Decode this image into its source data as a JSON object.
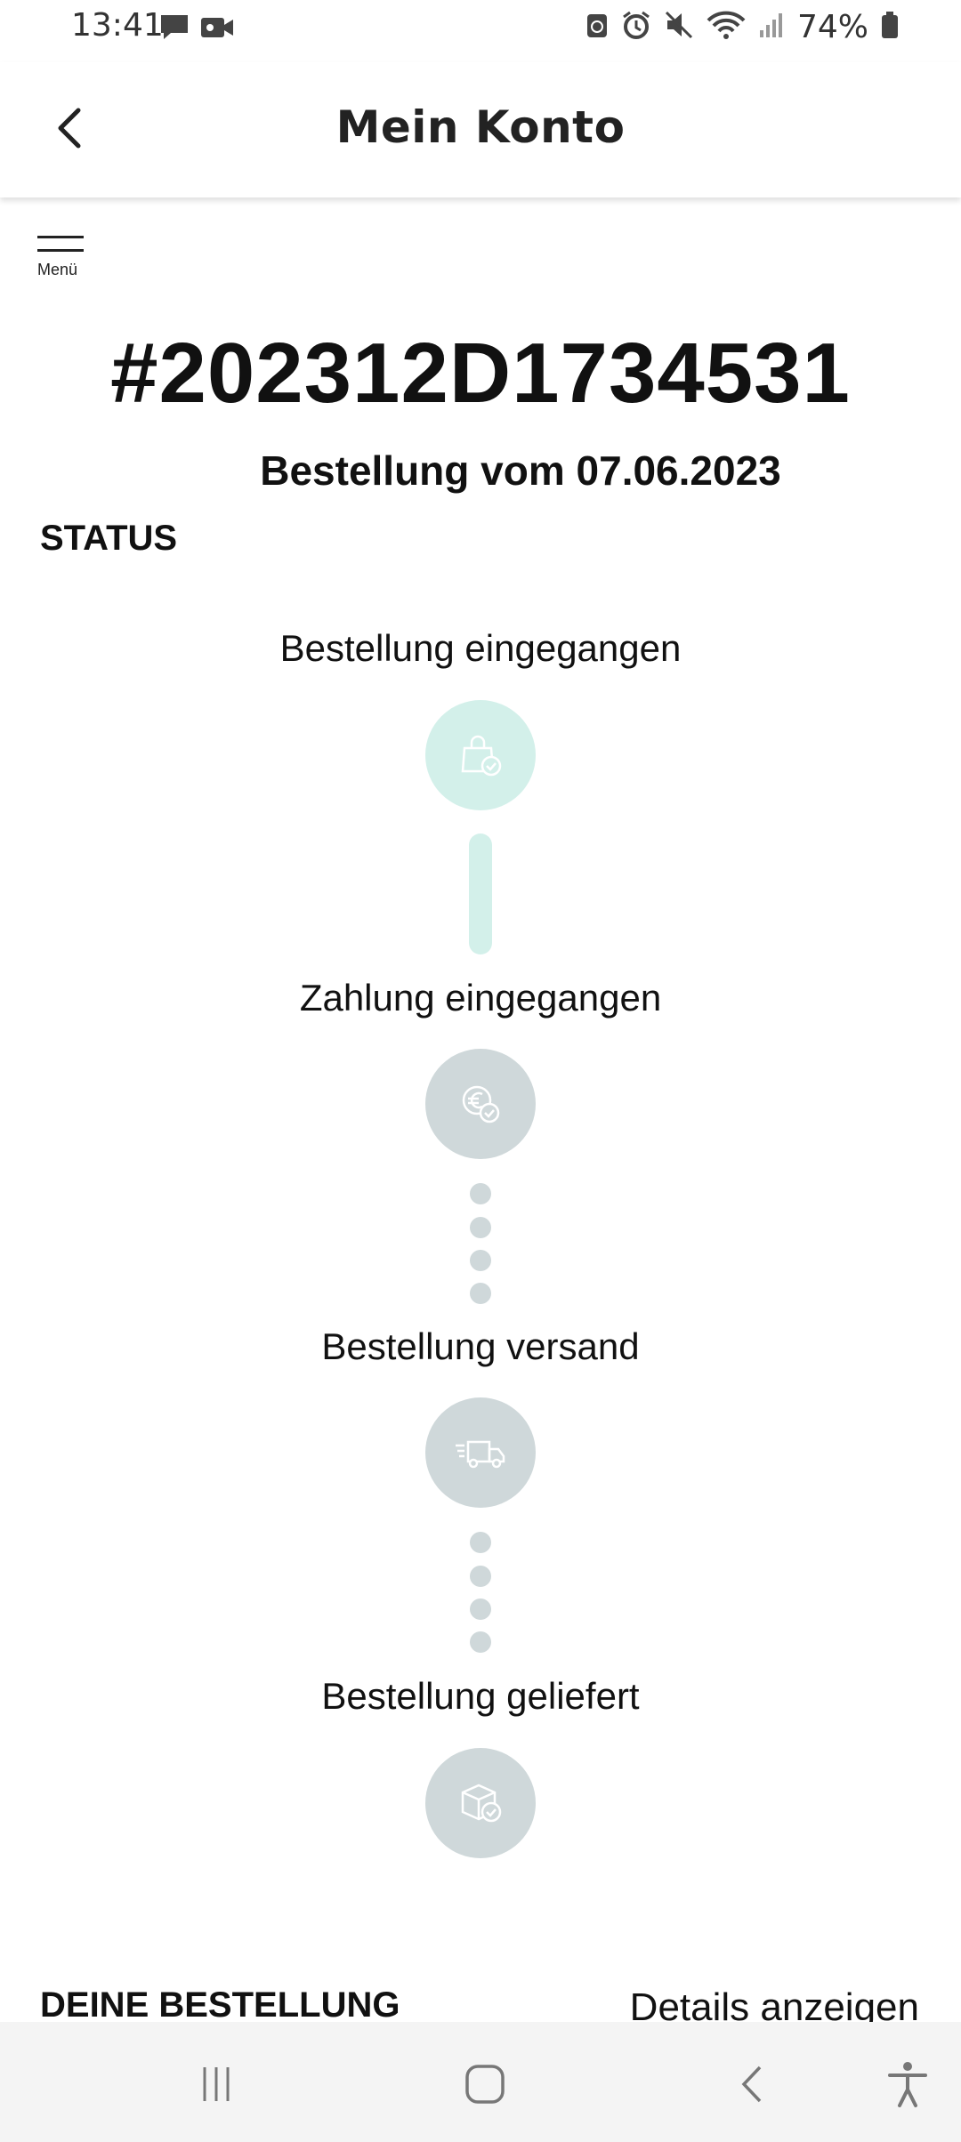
{
  "status_bar": {
    "time": "13:41",
    "battery": "74%",
    "icons": [
      "message-icon",
      "video-icon",
      "sync-icon",
      "alarm-icon",
      "mute-icon",
      "wifi-icon",
      "signal-icon",
      "battery-icon"
    ]
  },
  "header": {
    "title": "Mein Konto",
    "back_icon": "chevron-left-icon"
  },
  "menu": {
    "label": "Menü",
    "icon": "hamburger-icon"
  },
  "order": {
    "number": "#202312D1734531",
    "date": "Bestellung vom 07.06.2023"
  },
  "status_heading": "STATUS",
  "steps": [
    {
      "label": "Bestellung eingegangen",
      "icon": "shopping-bag-check-icon",
      "state": "done"
    },
    {
      "label": "Zahlung eingegangen",
      "icon": "euro-check-icon",
      "state": "pending"
    },
    {
      "label": "Bestellung versand",
      "icon": "delivery-truck-icon",
      "state": "pending"
    },
    {
      "label": "Bestellung geliefert",
      "icon": "package-check-icon",
      "state": "pending"
    }
  ],
  "your_order": {
    "heading": "DEINE BESTELLUNG",
    "details_link": "Details anzeigen"
  },
  "nav_bar": {
    "buttons": [
      "recent-apps-icon",
      "home-icon",
      "back-icon",
      "accessibility-icon"
    ]
  },
  "colors": {
    "step_active": "#d3f0ea",
    "step_inactive": "#cfd8da",
    "nav_background": "#f4f4f4"
  }
}
